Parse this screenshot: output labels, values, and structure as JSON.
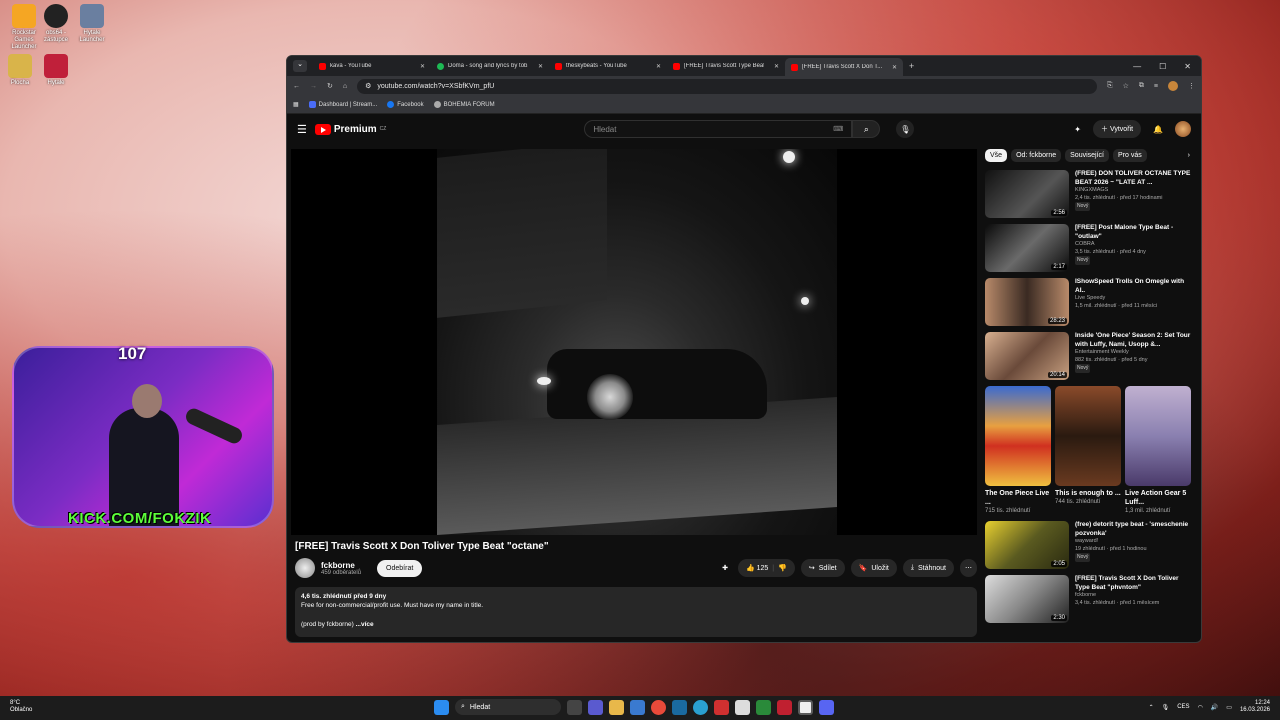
{
  "desktop": {
    "icons": [
      {
        "label": "Rockstar Games Launcher"
      },
      {
        "label": "obs64 - zástupce"
      },
      {
        "label": "Hytale Launcher"
      },
      {
        "label": "Plocha"
      },
      {
        "label": "Hytale"
      }
    ]
  },
  "stream": {
    "viewer_count": "107",
    "url": "KICK.COM/FOKZIK"
  },
  "browser": {
    "tabs": [
      {
        "label": "kava - YouTube"
      },
      {
        "label": "Doma - song and lyrics by tob..."
      },
      {
        "label": "theskybeats - YouTube"
      },
      {
        "label": "[FREE] Travis Scott Type Beat -..."
      },
      {
        "label": "[FREE] Travis Scott X Don T..."
      }
    ],
    "url": "youtube.com/watch?v=XSbfKVm_pfU",
    "bookmarks": [
      {
        "label": "Dashboard | Stream..."
      },
      {
        "label": "Facebook"
      },
      {
        "label": "BOHEMIA FORUM"
      }
    ]
  },
  "youtube": {
    "logo_text": "Premium",
    "logo_region": "CZ",
    "search_placeholder": "Hledat",
    "create_label": "Vytvořit",
    "video": {
      "title": "[FREE] Travis Scott X Don Toliver Type Beat \"octane\"",
      "channel": "fckborne",
      "subscribers": "459 odběratelů",
      "subscribe_label": "Odebírat",
      "likes": "125",
      "share_label": "Sdílet",
      "save_label": "Uložit",
      "download_label": "Stáhnout",
      "views_date": "4,6 tis. zhlédnutí  před 9 dny",
      "desc_line1": "Free for non-commercial/profit use. Must have my name in title.",
      "desc_line2": "(prod by fckborne)",
      "more_label": "...více"
    },
    "chips": [
      {
        "label": "Vše"
      },
      {
        "label": "Od: fckborne"
      },
      {
        "label": "Související"
      },
      {
        "label": "Pro vás"
      }
    ],
    "recommendations": [
      {
        "title": "(FREE) DON TOLIVER OCTANE TYPE BEAT 2026 ~ \"LATE AT ...",
        "channel": "KINGXMAGS",
        "meta": "2,4 tis. zhlédnutí · před 17 hodinami",
        "badge": "Nový",
        "duration": "2:56"
      },
      {
        "title": "[FREE] Post Malone Type Beat - \"outlaw\"",
        "channel": "COBRA",
        "meta": "3,5 tis. zhlédnutí · před 4 dny",
        "badge": "Nový",
        "duration": "2:17"
      },
      {
        "title": "IShowSpeed Trolls On Omegle with AI..",
        "channel": "Live Speedy",
        "meta": "1,5 mil. zhlédnutí · před 11 měsíci",
        "badge": "",
        "duration": "28:23"
      },
      {
        "title": "Inside 'One Piece' Season 2: Set Tour with Luffy, Nami, Usopp &...",
        "channel": "Entertainment Weekly",
        "meta": "882 tis. zhlédnutí · před 5 dny",
        "badge": "Nový",
        "duration": "20:14"
      }
    ],
    "shorts": [
      {
        "title": "The One Piece Live ...",
        "views": "715 tis. zhlédnutí"
      },
      {
        "title": "This is enough to ...",
        "views": "744 tis. zhlédnutí"
      },
      {
        "title": "Live Action Gear 5 Luff...",
        "views": "1,3 mil. zhlédnutí"
      }
    ],
    "more_recs": [
      {
        "title": "(free) detorit type beat - 'smeschenie pozvonka'",
        "channel": "wayward!",
        "meta": "19 zhlédnutí · před 1 hodinou",
        "badge": "Nový",
        "duration": "2:05"
      },
      {
        "title": "[FREE] Travis Scott X Don Toliver Type Beat \"phvntom\"",
        "channel": "fckborne",
        "meta": "3,4 tis. zhlédnutí · před 1 měsícem",
        "badge": "",
        "duration": "2:30"
      }
    ]
  },
  "taskbar": {
    "weather_temp": "8°C",
    "weather_desc": "Oblačno",
    "search_label": "Hledat",
    "lang": "CES",
    "time": "12:24",
    "date": "16.03.2026"
  }
}
